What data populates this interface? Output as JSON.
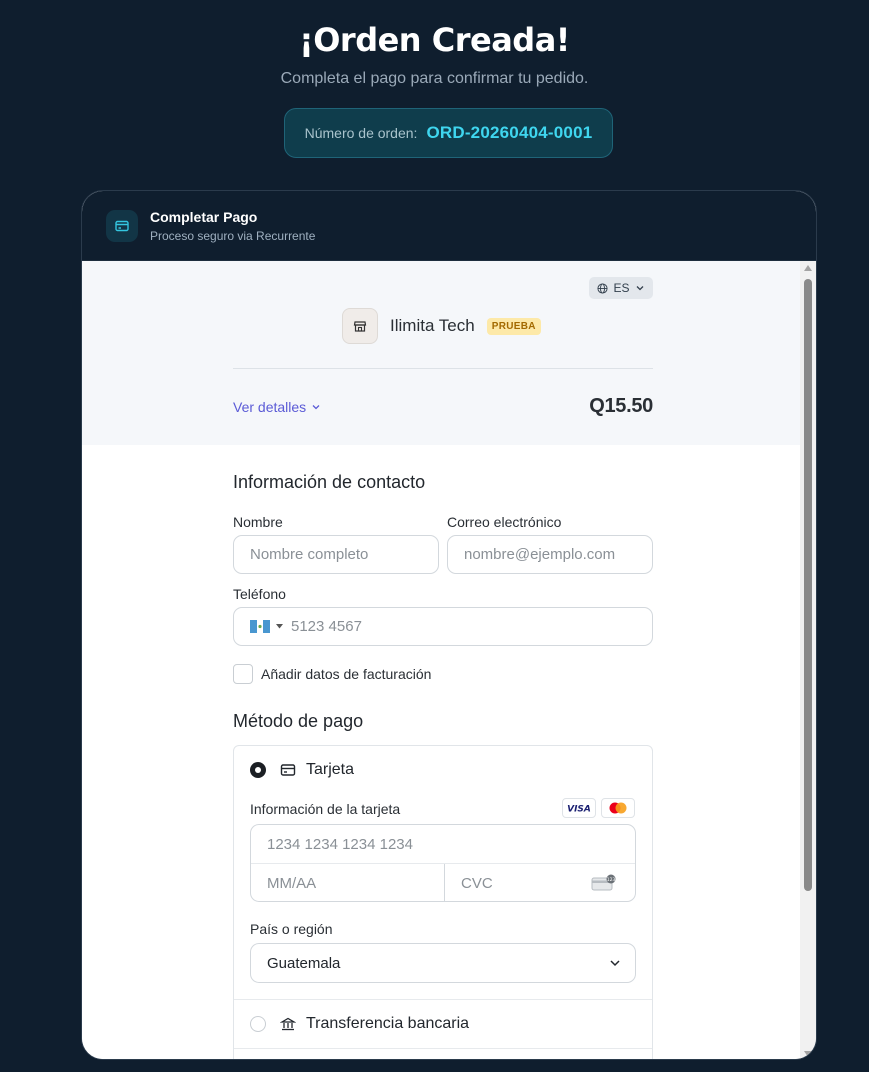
{
  "hero": {
    "title": "¡Orden Creada!",
    "subtitle": "Completa el pago para confirmar tu pedido.",
    "order_label": "Número de orden:",
    "order_number": "ORD-20260404-0001"
  },
  "modal": {
    "title": "Completar Pago",
    "subtitle": "Proceso seguro via Recurrente",
    "icon": "credit-card-icon"
  },
  "checkout": {
    "language": "ES",
    "merchant_name": "Ilimita Tech",
    "merchant_badge": "PRUEBA",
    "details_link": "Ver detalles",
    "total": "Q15.50",
    "contact": {
      "title": "Información de contacto",
      "name_label": "Nombre",
      "name_placeholder": "Nombre completo",
      "email_label": "Correo electrónico",
      "email_placeholder": "nombre@ejemplo.com",
      "phone_label": "Teléfono",
      "phone_placeholder": "5123 4567",
      "phone_country": "GT",
      "billing_checkbox_label": "Añadir datos de facturación",
      "billing_checked": false
    },
    "payment": {
      "title": "Método de pago",
      "options": [
        {
          "label": "Tarjeta",
          "icon": "credit-card-icon",
          "selected": true
        },
        {
          "label": "Transferencia bancaria",
          "icon": "bank-icon",
          "selected": false
        }
      ],
      "card_info_label": "Información de la tarjeta",
      "card_brands": [
        "VISA",
        "mastercard"
      ],
      "card_number_placeholder": "1234 1234 1234 1234",
      "expiry_placeholder": "MM/AA",
      "cvc_placeholder": "CVC",
      "country_label": "País o región",
      "country_value": "Guatemala"
    }
  },
  "colors": {
    "page_bg": "#0f1e2e",
    "accent_cyan": "#3fd6ef",
    "link": "#5b5bd6",
    "badge_bg": "#fde9a8",
    "badge_text": "#a36a00"
  }
}
